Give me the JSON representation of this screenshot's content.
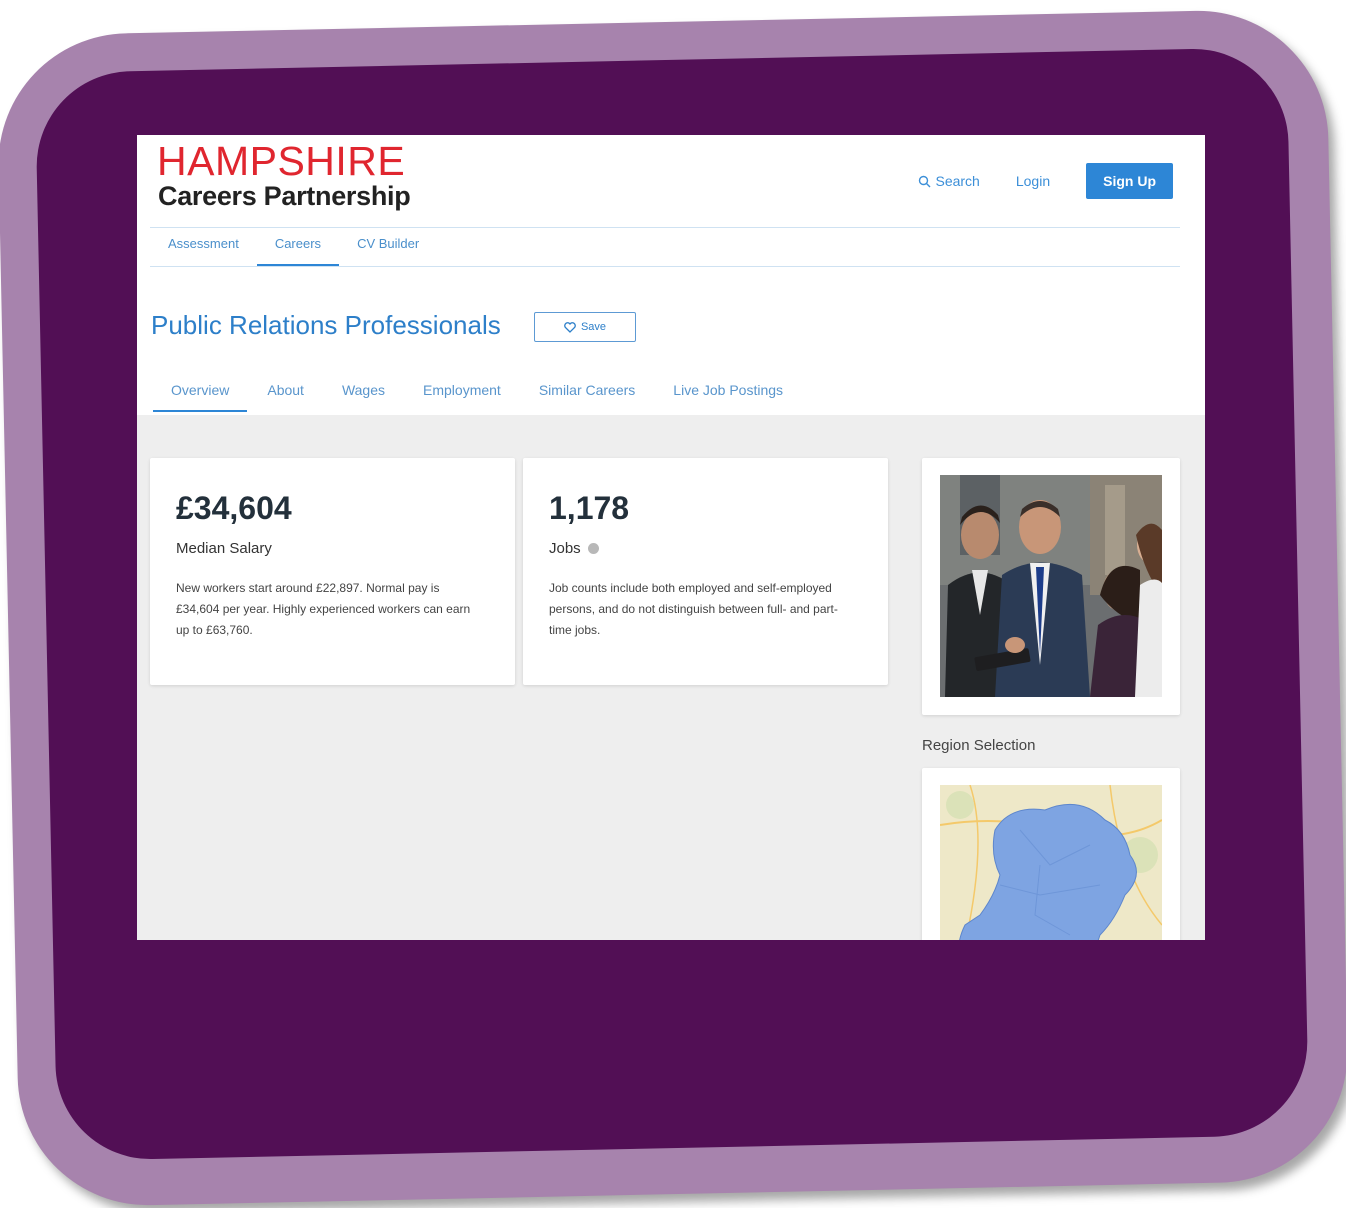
{
  "brand": {
    "title_top": "HAMPSHIRE",
    "title_bottom": "Careers Partnership",
    "colors": {
      "red": "#e0262f",
      "blue": "#2d86d6",
      "frame_purple": "#520f55",
      "frame_lilac": "#a783ad"
    }
  },
  "header": {
    "search_label": "Search",
    "search_icon": "search-icon",
    "login_label": "Login",
    "signup_label": "Sign Up"
  },
  "top_nav": {
    "items": [
      {
        "label": "Assessment",
        "active": false
      },
      {
        "label": "Careers",
        "active": true
      },
      {
        "label": "CV Builder",
        "active": false
      }
    ]
  },
  "career": {
    "title": "Public Relations Professionals",
    "save_label": "Save",
    "save_icon": "heart-icon"
  },
  "sub_nav": {
    "items": [
      {
        "label": "Overview",
        "active": true
      },
      {
        "label": "About",
        "active": false
      },
      {
        "label": "Wages",
        "active": false
      },
      {
        "label": "Employment",
        "active": false
      },
      {
        "label": "Similar Careers",
        "active": false
      },
      {
        "label": "Live Job Postings",
        "active": false
      }
    ]
  },
  "salary_card": {
    "value": "£34,604",
    "label": "Median Salary",
    "description": "New workers start around £22,897. Normal pay is £34,604 per year. Highly experienced workers can earn up to £63,760."
  },
  "jobs_card": {
    "value": "1,178",
    "label": "Jobs",
    "info_icon": "info-icon",
    "description": "Job counts include both employed and self-employed persons, and do not distinguish between full- and part-time jobs."
  },
  "sidebar": {
    "photo_icon": "business-people-photo",
    "region_label": "Region Selection",
    "map_icon": "hampshire-region-map"
  }
}
